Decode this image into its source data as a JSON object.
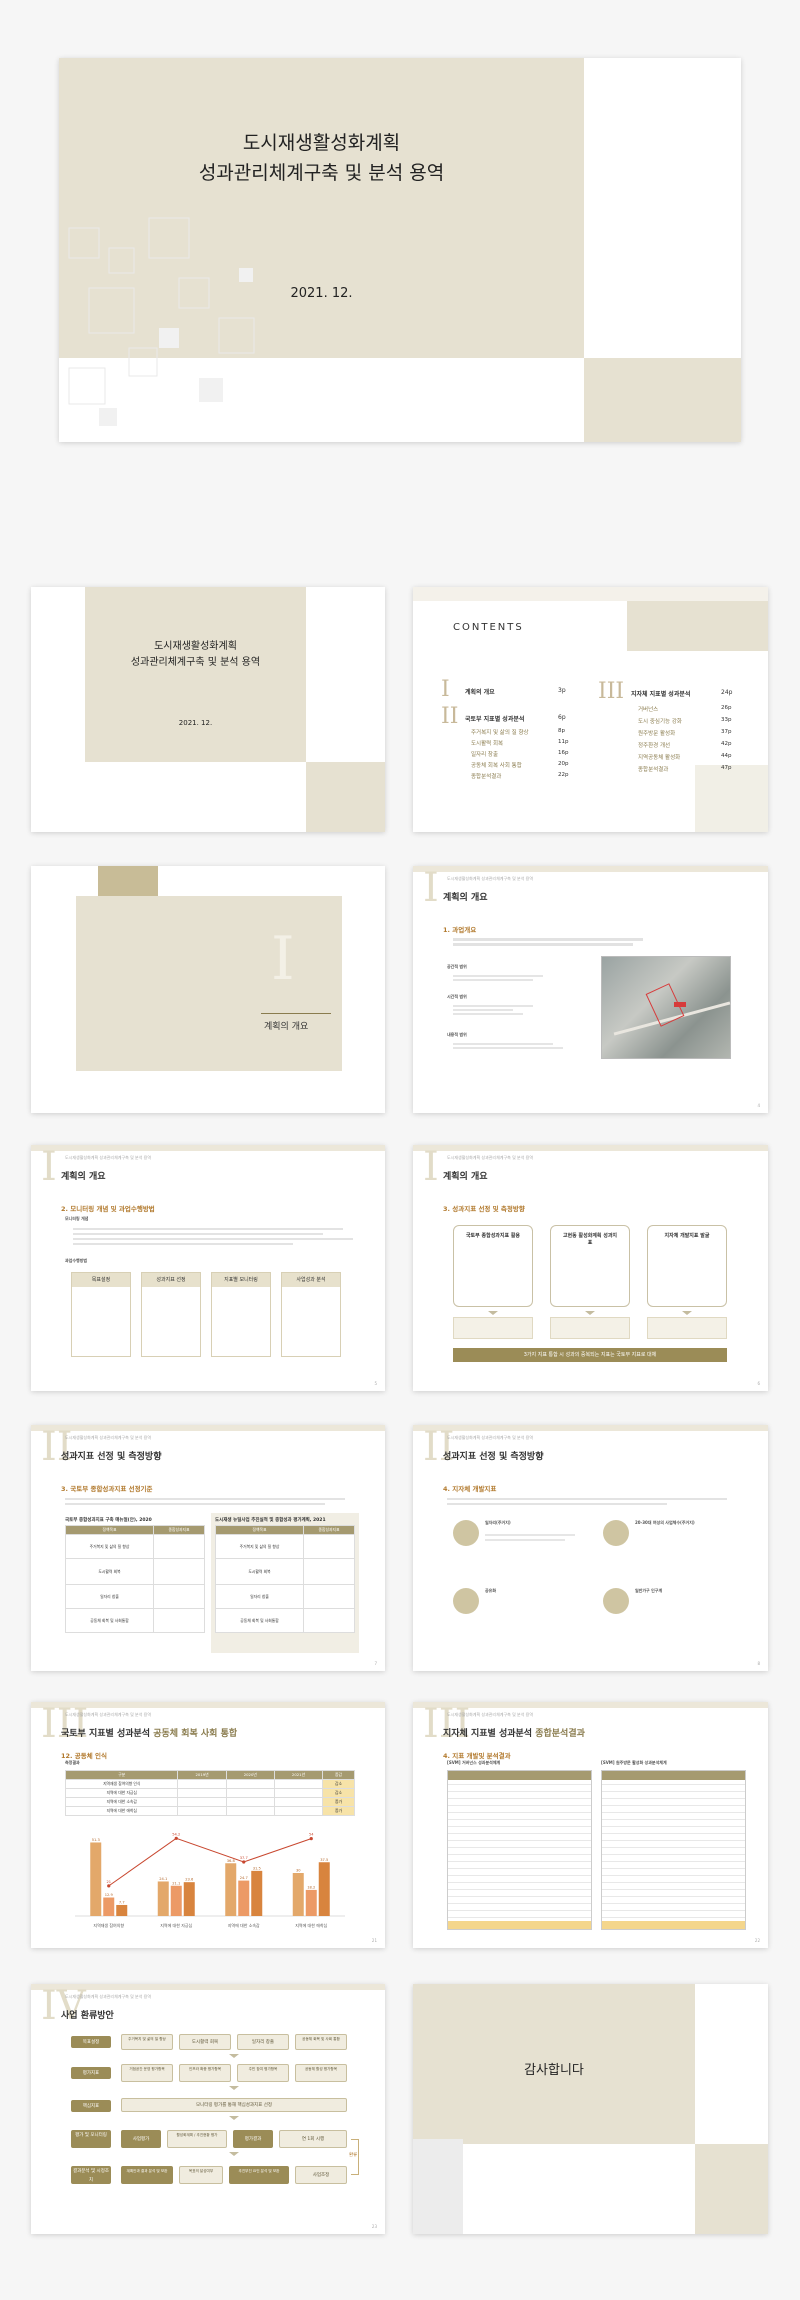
{
  "cover": {
    "title_line1": "도시재생활성화계획",
    "title_line2": "성과관리체계구축 및 분석 용역",
    "date": "2021. 12."
  },
  "contents": {
    "heading": "CONTENTS",
    "sections": [
      {
        "numeral": "I",
        "title": "계획의 개요",
        "page": "3p",
        "items": []
      },
      {
        "numeral": "II",
        "title": "국토부 지표별 성과분석",
        "page": "6p",
        "items": [
          {
            "label": "주거복지 및 삶의 질 향상",
            "page": "8p"
          },
          {
            "label": "도시활력 회복",
            "page": "11p"
          },
          {
            "label": "일자리 창출",
            "page": "16p"
          },
          {
            "label": "공동체 회복 사회 통합",
            "page": "20p"
          },
          {
            "label": "종합분석결과",
            "page": "22p"
          }
        ]
      },
      {
        "numeral": "III",
        "title": "지자체 지표별 성과분석",
        "page": "24p",
        "items": [
          {
            "label": "거버넌스",
            "page": "26p"
          },
          {
            "label": "도시 중심기능 강화",
            "page": "33p"
          },
          {
            "label": "원주방문 활성화",
            "page": "37p"
          },
          {
            "label": "정주환경 개선",
            "page": "42p"
          },
          {
            "label": "지역공동체 활성화",
            "page": "44p"
          },
          {
            "label": "종합분석결과",
            "page": "47p"
          }
        ]
      }
    ]
  },
  "divider": {
    "numeral": "I",
    "title": "계획의 개요"
  },
  "header_small": "도시재생활성화계획 성과관리체계구축 및 분석 용역",
  "slide_overview": {
    "numeral": "I",
    "title": "계획의 개요",
    "section": "1. 과업개요",
    "bullets": [
      "공간적 범위",
      "시간적 범위",
      "내용적 범위"
    ],
    "page": "4"
  },
  "slide_method": {
    "numeral": "I",
    "title": "계획의 개요",
    "section": "2. 모니터링 개념 및 과업수행방법",
    "sub1": "모니터링 개념",
    "sub2": "과업수행방법",
    "steps": [
      "목표설정",
      "성과지표 선정",
      "지표별 모니터링",
      "사업성과 분석"
    ],
    "page": "5"
  },
  "slide_indicators_intro": {
    "numeral": "I",
    "title": "계획의 개요",
    "section": "3. 성과지표 선정 및 측정방향",
    "cards": [
      "국토부 종합성과지표 활용",
      "고현동 활성화계획 성과지표",
      "지자체 개발지표 발굴"
    ],
    "banner": "3가지 지표 통합 시 성과의 중복되는 지표는 국토부 지표로 대체",
    "page": "6"
  },
  "slide_selection": {
    "numeral": "II",
    "title": "성과지표 선정 및 측정방향",
    "section": "3. 국토부 종합성과지표 선정기준",
    "left_caption": "국토부 종합성과지표 구축 매뉴얼(안), 2020",
    "right_caption": "도시재생 뉴딜사업 추진실적 및 종합성과 평가계획, 2021",
    "col_headers": [
      "정책목표",
      "종합성과지표"
    ],
    "rows": [
      "주거복지 및 삶의 질 향상",
      "도시활력 회복",
      "일자리 창출",
      "공동체 회복 및 사회통합"
    ],
    "page": "7"
  },
  "slide_local": {
    "numeral": "II",
    "title": "성과지표 선정 및 측정방향",
    "section": "4. 지자체 개발지표",
    "quads": [
      "일자리(주거지)",
      "20-30대 여성의 사업체수(주거지)",
      "공유화",
      "일반가구 인구계"
    ],
    "page": "8"
  },
  "slide_community": {
    "numeral": "III",
    "title": "국토부 지표별 성과분석",
    "title_accent": "공동체 회복 사회 통합",
    "section": "12. 공동체 인식",
    "sub": "측정결과",
    "table_headers": [
      "구분",
      "2019년",
      "2020년",
      "2021년",
      "증감"
    ],
    "table_rows": [
      [
        "지역재생 참여의향 인식",
        "",
        "",
        "",
        "감소"
      ],
      [
        "지역에 대한 자긍심",
        "",
        "",
        "",
        "감소"
      ],
      [
        "지역에 대한 소속감",
        "",
        "",
        "",
        "증가"
      ],
      [
        "지역에 대한 애착심",
        "",
        "",
        "",
        "증가"
      ]
    ],
    "page": "21"
  },
  "chart_data": {
    "type": "bar",
    "title": "",
    "xlabel": "",
    "ylabel": "",
    "categories": [
      "지역재생 참여의향",
      "지역에 대한 자긍심",
      "지역에 대한 소속감",
      "지역에 대한 애착심"
    ],
    "series": [
      {
        "name": "",
        "values": [
          51.3,
          24.1,
          36.8,
          30.0
        ],
        "color": "#e3a86a"
      },
      {
        "name": "",
        "values": [
          12.9,
          21.1,
          24.7,
          18.2
        ],
        "color": "#ec9a66"
      },
      {
        "name": "",
        "values": [
          7.7,
          23.6,
          31.5,
          37.5
        ],
        "color": "#d8843e"
      }
    ],
    "line": [
      21.0,
      54.2,
      37.7,
      54.0
    ],
    "ylim": [
      0,
      60
    ]
  },
  "slide_results": {
    "numeral": "III",
    "title": "지자체 지표별 성과분석",
    "title_accent": "종합분석결과",
    "section": "4. 지표 개발및 분석결과",
    "left_sub": "[SVM] 거버넌스 성과분석체계",
    "right_sub": "[SVM] 원주방문 활성화 성과분석체계",
    "page": "22"
  },
  "slide_plan": {
    "numeral": "IV",
    "title": "사업 환류방안",
    "rows": [
      {
        "label": "목표설정",
        "boxes": [
          "주거복지 및 삶의 질 향상",
          "도시활력 회복",
          "일자리 창출",
          "공동체 회복 및 사회 통합"
        ]
      },
      {
        "label": "평가지표",
        "boxes": [
          "거점공간 운영 평가항목",
          "인프라 확충 평가항목",
          "주민 참여 평가항목",
          "공동체 활성 평가항목"
        ]
      },
      {
        "label": "핵심지표",
        "boxes": [
          "모니터링 평가를 통해 핵심성과지표 선정"
        ]
      },
      {
        "label": "평가 및 모니터링",
        "boxes": [
          "사업평가",
          "활성화계획 / 추진현황 평가",
          "평가결과",
          "연 1회 시행"
        ]
      },
      {
        "label": "결과분석 및 시정조치",
        "boxes": [
          "계획안과 결과 분석 및 보완",
          "목표의 달성여부",
          "추진부진 요인 분석 및 보완",
          "사업조정"
        ]
      }
    ],
    "feedback": "환류",
    "page": "23"
  },
  "thanks": "감사합니다"
}
